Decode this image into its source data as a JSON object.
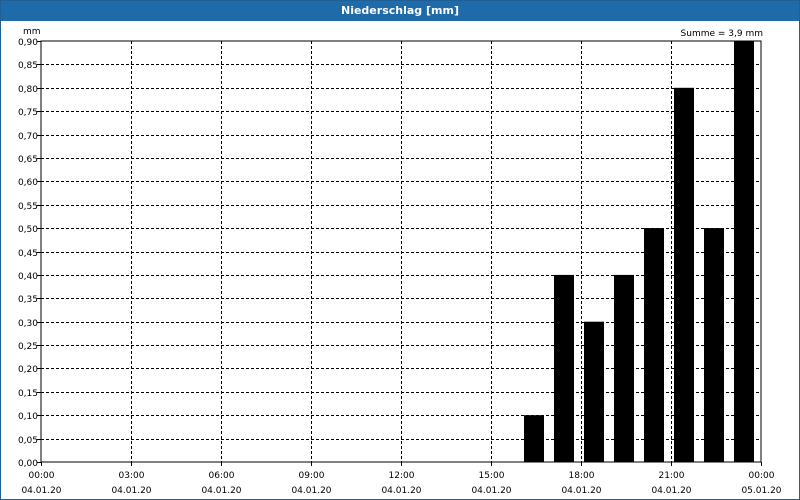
{
  "title": "Niederschlag [mm]",
  "chart_data": {
    "type": "bar",
    "title": "Niederschlag [mm]",
    "annotation": "Summe = 3,9 mm",
    "ylabel": "mm",
    "ylim": [
      0,
      0.9
    ],
    "yticks": [
      "0,00",
      "0,05",
      "0,10",
      "0,15",
      "0,20",
      "0,25",
      "0,30",
      "0,35",
      "0,40",
      "0,45",
      "0,50",
      "0,55",
      "0,60",
      "0,65",
      "0,70",
      "0,75",
      "0,80",
      "0,85",
      "0,90"
    ],
    "xlim": [
      "04.01.20 00:00",
      "05.01.20 00:00"
    ],
    "xticks": [
      {
        "time": "00:00",
        "date": "04.01.20"
      },
      {
        "time": "03:00",
        "date": "04.01.20"
      },
      {
        "time": "06:00",
        "date": "04.01.20"
      },
      {
        "time": "09:00",
        "date": "04.01.20"
      },
      {
        "time": "12:00",
        "date": "04.01.20"
      },
      {
        "time": "15:00",
        "date": "04.01.20"
      },
      {
        "time": "18:00",
        "date": "04.01.20"
      },
      {
        "time": "21:00",
        "date": "04.01.20"
      },
      {
        "time": "00:00",
        "date": "05.01.20"
      }
    ],
    "bars": [
      {
        "x": "04.01.20 16:00",
        "value": 0.1
      },
      {
        "x": "04.01.20 17:00",
        "value": 0.4
      },
      {
        "x": "04.01.20 18:00",
        "value": 0.3
      },
      {
        "x": "04.01.20 19:00",
        "value": 0.4
      },
      {
        "x": "04.01.20 20:00",
        "value": 0.5
      },
      {
        "x": "04.01.20 21:00",
        "value": 0.8
      },
      {
        "x": "04.01.20 22:00",
        "value": 0.5
      },
      {
        "x": "04.01.20 23:00",
        "value": 0.9
      }
    ],
    "grid": true,
    "bar_color": "#000000"
  }
}
